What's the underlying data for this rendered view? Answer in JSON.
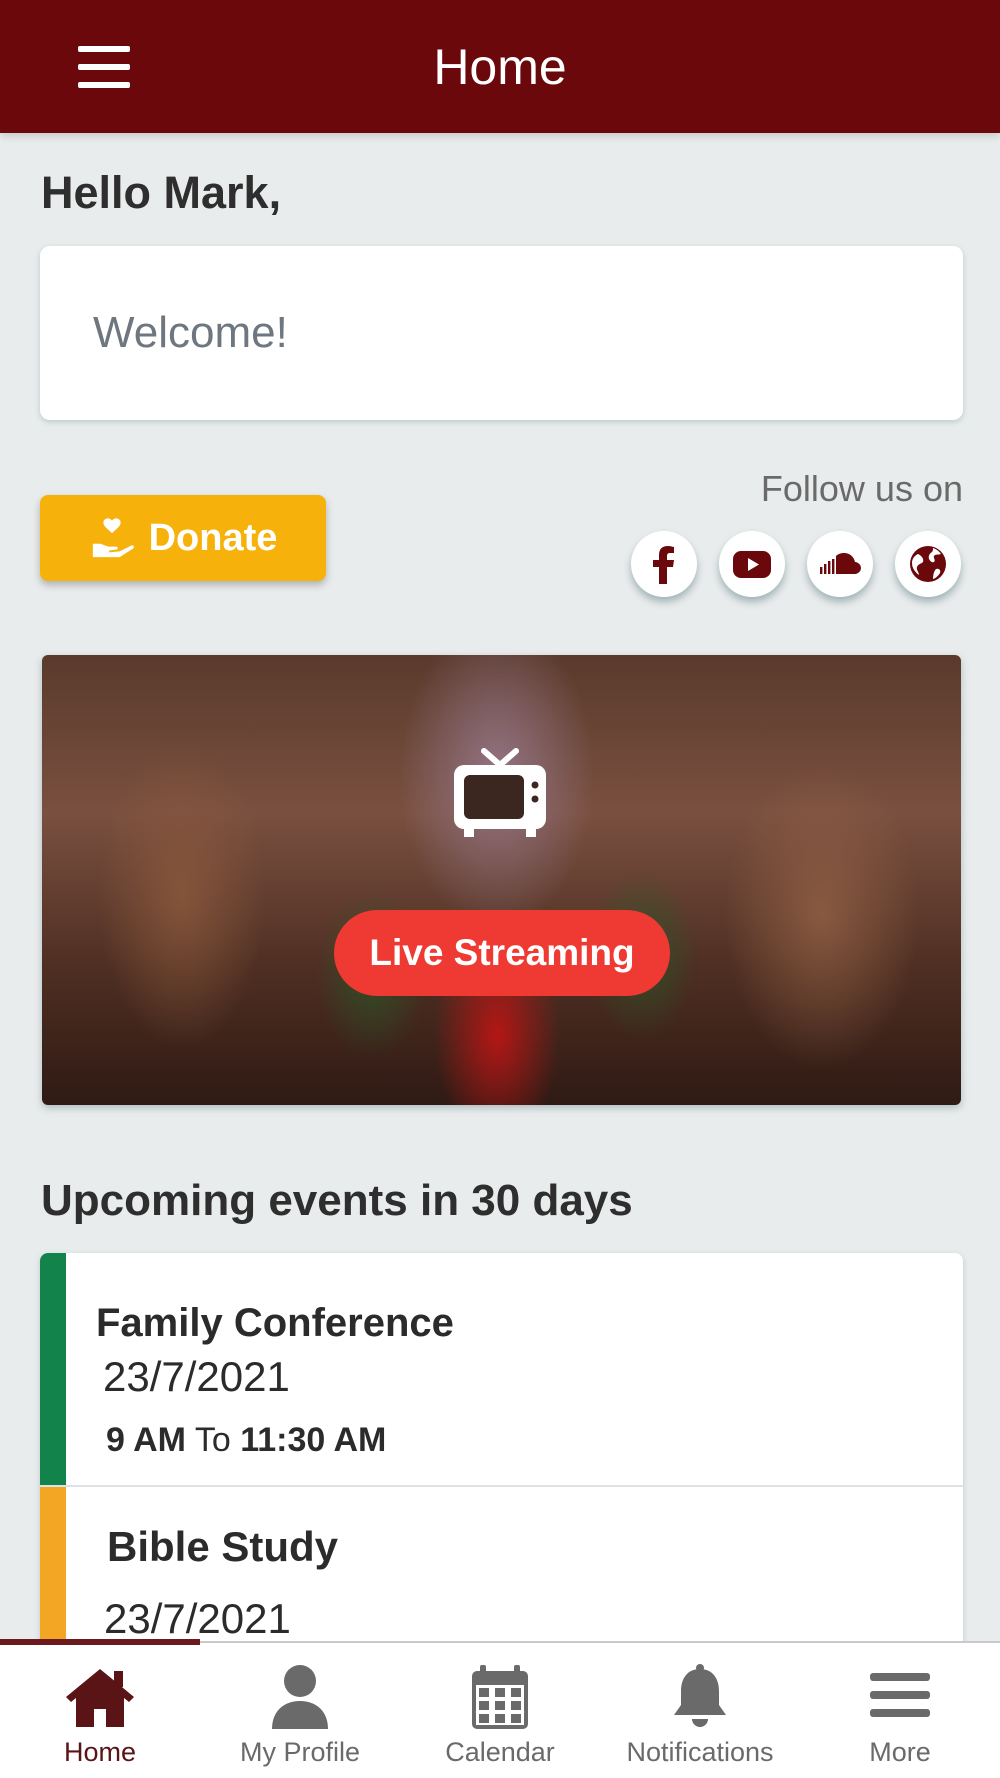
{
  "header": {
    "title": "Home",
    "menu_icon": "hamburger-menu-icon"
  },
  "greeting": "Hello Mark,",
  "welcome_message": "Welcome!",
  "donate": {
    "label": "Donate",
    "icon": "hand-heart-icon"
  },
  "follow": {
    "label": "Follow us on",
    "links": [
      {
        "name": "facebook",
        "icon": "facebook-icon"
      },
      {
        "name": "youtube",
        "icon": "youtube-icon"
      },
      {
        "name": "soundcloud",
        "icon": "soundcloud-icon"
      },
      {
        "name": "website",
        "icon": "globe-icon"
      }
    ]
  },
  "stream": {
    "label": "Live Streaming",
    "icon": "tv-icon"
  },
  "events": {
    "title": "Upcoming events in 30 days",
    "items": [
      {
        "name": "Family Conference",
        "date": "23/7/2021",
        "start": "9 AM",
        "separator": "To",
        "end": "11:30 AM",
        "color": "#12834a"
      },
      {
        "name": "Bible Study",
        "date": "23/7/2021",
        "color": "#f3a623"
      }
    ]
  },
  "nav": {
    "items": [
      {
        "label": "Home",
        "icon": "home-icon",
        "active": true
      },
      {
        "label": "My Profile",
        "icon": "user-icon",
        "active": false
      },
      {
        "label": "Calendar",
        "icon": "calendar-icon",
        "active": false
      },
      {
        "label": "Notifications",
        "icon": "bell-icon",
        "active": false
      },
      {
        "label": "More",
        "icon": "more-icon",
        "active": false
      }
    ]
  },
  "colors": {
    "primary": "#6b080c",
    "donate": "#f6b20b",
    "live": "#ef3a33",
    "background": "#e9ecec"
  }
}
